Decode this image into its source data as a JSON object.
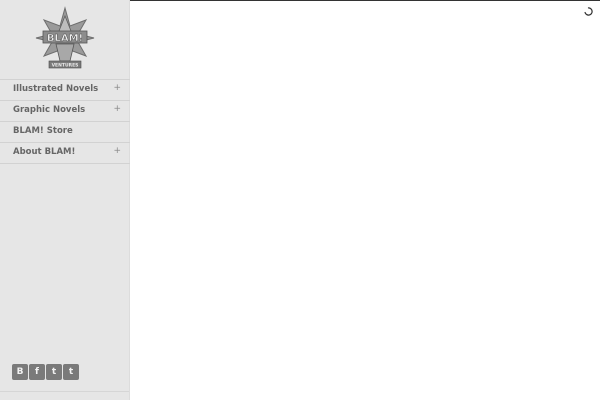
{
  "nav": {
    "items": [
      {
        "label": "Illustrated Novels",
        "expand": "+"
      },
      {
        "label": "Graphic Novels",
        "expand": "+"
      },
      {
        "label": "BLAM! Store",
        "expand": ""
      },
      {
        "label": "About BLAM!",
        "expand": "+"
      }
    ]
  },
  "social": {
    "blogger": "B",
    "facebook": "f",
    "tumblr": "t",
    "twitter": "t"
  },
  "icons": {
    "logo": "blam-ventures-logo",
    "spinner": "loading-spinner-icon"
  },
  "colors": {
    "sidebar_bg": "#e6e6e6",
    "nav_text": "#666666",
    "social_bg": "#7a7a7a"
  }
}
